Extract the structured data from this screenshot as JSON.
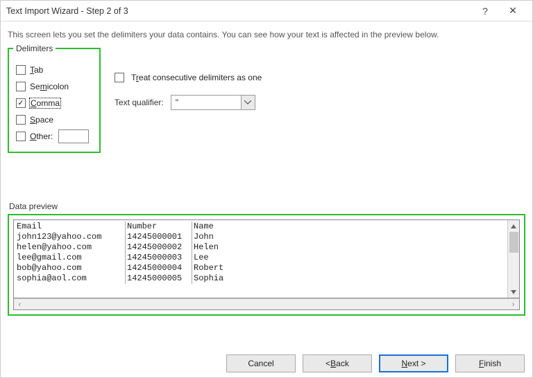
{
  "window": {
    "title": "Text Import Wizard - Step 2 of 3",
    "help_glyph": "?",
    "close_glyph": "✕"
  },
  "description": "This screen lets you set the delimiters your data contains.  You can see how your text is affected in the preview below.",
  "delimiters": {
    "legend": "Delimiters",
    "tab": {
      "label_pre": "",
      "accel": "T",
      "label_post": "ab",
      "checked": false
    },
    "semicolon": {
      "label_pre": "Se",
      "accel": "m",
      "label_post": "icolon",
      "checked": false
    },
    "comma": {
      "label_pre": "",
      "accel": "C",
      "label_post": "omma",
      "checked": true,
      "focused": true
    },
    "space": {
      "label_pre": "",
      "accel": "S",
      "label_post": "pace",
      "checked": false
    },
    "other": {
      "label_pre": "",
      "accel": "O",
      "label_post": "ther:",
      "checked": false,
      "value": ""
    }
  },
  "options": {
    "treat_consecutive": {
      "label_pre": "T",
      "accel": "r",
      "label_post": "eat consecutive delimiters as one",
      "checked": false
    },
    "text_qualifier_label_pre": "Text ",
    "text_qualifier_accel": "q",
    "text_qualifier_label_post": "ualifier:",
    "text_qualifier_value": "\""
  },
  "preview": {
    "label_pre": "Data ",
    "accel": "p",
    "label_post": "review",
    "columns": [
      [
        "Email",
        "john123@yahoo.com",
        "helen@yahoo.com",
        "lee@gmail.com",
        "bob@yahoo.com",
        "sophia@aol.com"
      ],
      [
        "Number",
        "14245000001",
        "14245000002",
        "14245000003",
        "14245000004",
        "14245000005"
      ],
      [
        "Name",
        "John",
        "Helen",
        "Lee",
        "Robert",
        "Sophia"
      ]
    ]
  },
  "buttons": {
    "cancel": {
      "text": "Cancel"
    },
    "back": {
      "pre": "< ",
      "accel": "B",
      "post": "ack"
    },
    "next": {
      "accel": "N",
      "post": "ext >"
    },
    "finish": {
      "accel": "F",
      "post": "inish"
    }
  }
}
